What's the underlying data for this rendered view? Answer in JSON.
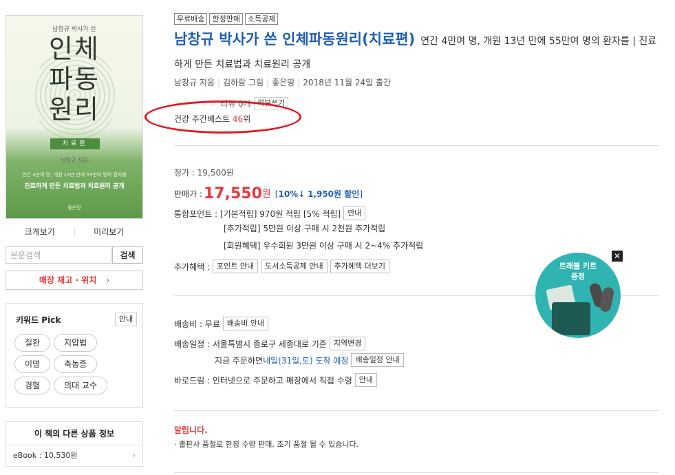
{
  "cover": {
    "author": "남창규 박사가 쓴",
    "title_line1": "인체",
    "title_line2": "파동",
    "title_line3": "원리",
    "badge": "치료편",
    "sub": "- 남창규 지음 -",
    "blurb1": "연간 4만여 명, 개원 13년 만에 55만여 명의 환자를",
    "blurb2": "진료하게 만든 치료법과 치료원리 공개",
    "publisher": "좋은땅"
  },
  "cover_links": {
    "zoom": "크게보기",
    "preview": "미리보기"
  },
  "search": {
    "placeholder": "본문검색",
    "button": "검색"
  },
  "stock_button": {
    "label": "매장 재고 · 위치",
    "chevron": "›"
  },
  "keyword": {
    "title": "키워드 Pick",
    "guide": "안내",
    "tags": [
      "질환",
      "지압법",
      "이명",
      "축농증",
      "경혈",
      "의대 교수"
    ]
  },
  "other": {
    "title": "이 책의 다른 상품 정보",
    "ebook": "eBook : 10,530원",
    "chevron": "›"
  },
  "badges": [
    "무료배송",
    "한정판매",
    "소득공제"
  ],
  "product": {
    "title": "남창규 박사가 쓴 인체파동원리(치료편)",
    "subtitle": "연간 4만여 명, 개원 13년 만에 55만여 명의 환자를 | 진료하게 만든 치료법과 치료원리 공개"
  },
  "byline": {
    "author": "남창규 지음",
    "illustrator": "김하람 그림",
    "publisher": "좋은땅",
    "date": "2018년 11월 24일 출간"
  },
  "rating": {
    "stars": "☆☆☆☆☆",
    "count": "리뷰 0개",
    "review_button": "리뷰쓰기",
    "score_out_of_5": 0
  },
  "bestseller": {
    "prefix": "건강 주간베스트 ",
    "rank": "46",
    "suffix": "위"
  },
  "price": {
    "list_label": "정가 : 19,500원",
    "sale_label": "판매가 :",
    "sale_value": "17,550",
    "won": "원",
    "discount_open": "[",
    "discount_rate": "10%↓",
    "discount_amount": "1,950원 할인",
    "discount_close": "]"
  },
  "points": {
    "label": "통합포인트 :",
    "basic": "[기본적립] 970원 적립 [5% 적립]",
    "guide": "안내",
    "extra": "[추가적립] 5만원 이상 구매 시 2천원 추가적립",
    "member": "[회원혜택] 우수회원 3만원 이상 구매 시 2~4% 추가적립"
  },
  "benefits": {
    "label": "추가혜택 :",
    "buttons": [
      "포인트 안내",
      "도서소득공제 안내",
      "추가혜택 더보기"
    ]
  },
  "shipping": {
    "fee_label": "배송비 : 무료",
    "fee_guide": "배송비 안내",
    "schedule_label": "배송일정 : 서울특별시 종로구 세종대로 기준",
    "region_change": "지역변경",
    "order_now": "지금 주문하면 ",
    "eta": "내일(31일,토) 도착 예정",
    "schedule_guide": "배송일정 안내",
    "barodrim": "바로드림 : 인터넷으로 주문하고 매장에서 직접 수령",
    "barodrim_guide": "안내"
  },
  "notice": {
    "title": "알립니다.",
    "text": "· 출판사 품절로 한정 수량 판매, 조기 품절 될 수 있습니다."
  },
  "promo": {
    "line1": "트래블 키트",
    "line2": "증정",
    "close": "✕"
  },
  "colors": {
    "accent_blue": "#1d5fb1",
    "price_red": "#e4393c",
    "promo_teal": "#2fb4b1",
    "annotation_red": "#e3161d"
  }
}
